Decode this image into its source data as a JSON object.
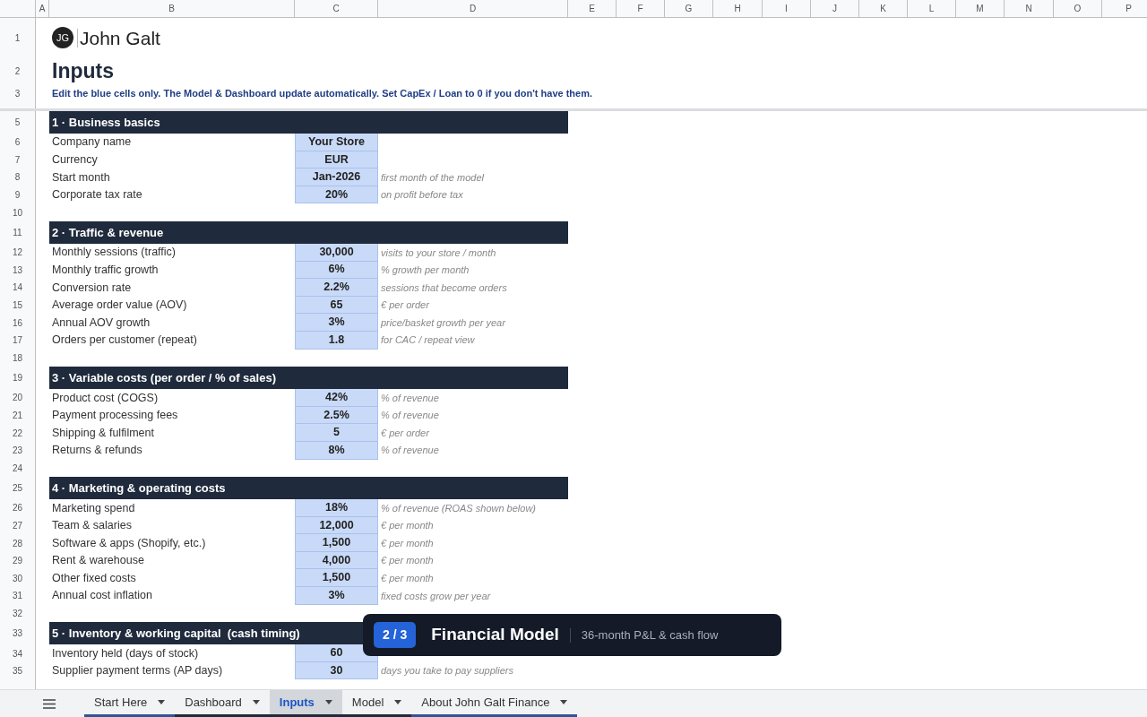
{
  "columns": [
    "A",
    "B",
    "C",
    "D",
    "E",
    "F",
    "G",
    "H",
    "I",
    "J",
    "K",
    "L",
    "M",
    "N",
    "O",
    "P"
  ],
  "rows": [
    {
      "num": "1",
      "kind": "author",
      "initials": "JG",
      "label": "John Galt"
    },
    {
      "num": "2",
      "kind": "title",
      "label": "Inputs"
    },
    {
      "num": "3",
      "kind": "instruction",
      "label": "Edit the blue cells only. The Model & Dashboard update automatically. Set CapEx / Loan to 0 if you don't have them."
    },
    {
      "num": "5",
      "kind": "header",
      "label": "1 · Business basics"
    },
    {
      "num": "6",
      "kind": "field",
      "label": "Company name",
      "value": "Your Store"
    },
    {
      "num": "7",
      "kind": "field",
      "label": "Currency",
      "value": "EUR"
    },
    {
      "num": "8",
      "kind": "field",
      "label": "Start month",
      "value": "Jan-2026",
      "note": "first month of the model"
    },
    {
      "num": "9",
      "kind": "field",
      "label": "Corporate tax rate",
      "value": "20%",
      "note": "on profit before tax"
    },
    {
      "num": "10",
      "kind": "blank"
    },
    {
      "num": "11",
      "kind": "header",
      "label": "2 · Traffic & revenue"
    },
    {
      "num": "12",
      "kind": "field",
      "label": "Monthly sessions (traffic)",
      "value": "30,000",
      "note": "visits to your store / month"
    },
    {
      "num": "13",
      "kind": "field",
      "label": "Monthly traffic growth",
      "value": "6%",
      "note": "% growth per month"
    },
    {
      "num": "14",
      "kind": "field",
      "label": "Conversion rate",
      "value": "2.2%",
      "note": "sessions that become orders"
    },
    {
      "num": "15",
      "kind": "field",
      "label": "Average order value (AOV)",
      "value": "65",
      "note": "€ per order"
    },
    {
      "num": "16",
      "kind": "field",
      "label": "Annual AOV growth",
      "value": "3%",
      "note": "price/basket growth per year"
    },
    {
      "num": "17",
      "kind": "field",
      "label": "Orders per customer (repeat)",
      "value": "1.8",
      "note": "for CAC / repeat view"
    },
    {
      "num": "18",
      "kind": "blank"
    },
    {
      "num": "19",
      "kind": "header",
      "label": "3 · Variable costs (per order / % of sales)"
    },
    {
      "num": "20",
      "kind": "field",
      "label": "Product cost (COGS)",
      "value": "42%",
      "note": "% of revenue"
    },
    {
      "num": "21",
      "kind": "field",
      "label": "Payment processing fees",
      "value": "2.5%",
      "note": "% of revenue"
    },
    {
      "num": "22",
      "kind": "field",
      "label": "Shipping & fulfilment",
      "value": "5",
      "note": "€ per order"
    },
    {
      "num": "23",
      "kind": "field",
      "label": "Returns & refunds",
      "value": "8%",
      "note": "% of revenue"
    },
    {
      "num": "24",
      "kind": "blank"
    },
    {
      "num": "25",
      "kind": "header",
      "label": "4 · Marketing & operating costs"
    },
    {
      "num": "26",
      "kind": "field",
      "label": "Marketing spend",
      "value": "18%",
      "note": "% of revenue (ROAS shown below)"
    },
    {
      "num": "27",
      "kind": "field",
      "label": "Team & salaries",
      "value": "12,000",
      "note": "€ per month"
    },
    {
      "num": "28",
      "kind": "field",
      "label": "Software & apps (Shopify, etc.)",
      "value": "1,500",
      "note": "€ per month"
    },
    {
      "num": "29",
      "kind": "field",
      "label": "Rent & warehouse",
      "value": "4,000",
      "note": "€ per month"
    },
    {
      "num": "30",
      "kind": "field",
      "label": "Other fixed costs",
      "value": "1,500",
      "note": "€ per month"
    },
    {
      "num": "31",
      "kind": "field",
      "label": "Annual cost inflation",
      "value": "3%",
      "note": "fixed costs grow per year"
    },
    {
      "num": "32",
      "kind": "blank"
    },
    {
      "num": "33",
      "kind": "header",
      "label": "5 · Inventory & working capital  (cash timing)"
    },
    {
      "num": "34",
      "kind": "field",
      "label": "Inventory held (days of stock)",
      "value": "60"
    },
    {
      "num": "35",
      "kind": "field",
      "label": "Supplier payment terms (AP days)",
      "value": "30",
      "note": "days you take to pay suppliers"
    }
  ],
  "toast": {
    "step": "2 / 3",
    "title": "Financial Model",
    "subtitle": "36-month P&L & cash flow"
  },
  "tabs": [
    {
      "label": "Start Here",
      "selected": false,
      "color": "#2f5597"
    },
    {
      "label": "Dashboard",
      "selected": false,
      "color": "#1f2a3c"
    },
    {
      "label": "Inputs",
      "selected": true,
      "color": "#1f2a3c"
    },
    {
      "label": "Model",
      "selected": false,
      "color": "#1f2a3c"
    },
    {
      "label": "About John Galt Finance",
      "selected": false,
      "color": "#2f5597"
    }
  ]
}
